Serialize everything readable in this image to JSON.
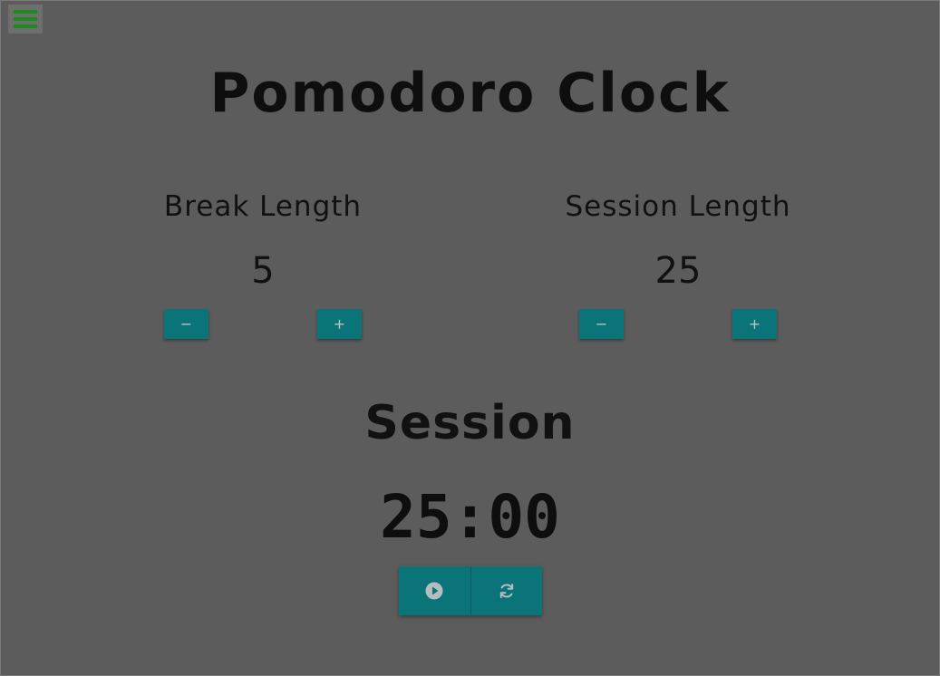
{
  "menu": {
    "icon": "hamburger-menu-icon"
  },
  "title": "Pomodoro Clock",
  "break": {
    "label": "Break Length",
    "value": "5",
    "decrement": "−",
    "increment": "+"
  },
  "session": {
    "label": "Session Length",
    "value": "25",
    "decrement": "−",
    "increment": "+"
  },
  "timer": {
    "mode": "Session",
    "time": "25:00"
  },
  "controls": {
    "start_icon": "play-icon",
    "reset_icon": "refresh-icon"
  },
  "colors": {
    "background": "#5c5c5c",
    "button": "#0b7479",
    "menu_icon": "#1a8c1a",
    "text": "#111111"
  }
}
